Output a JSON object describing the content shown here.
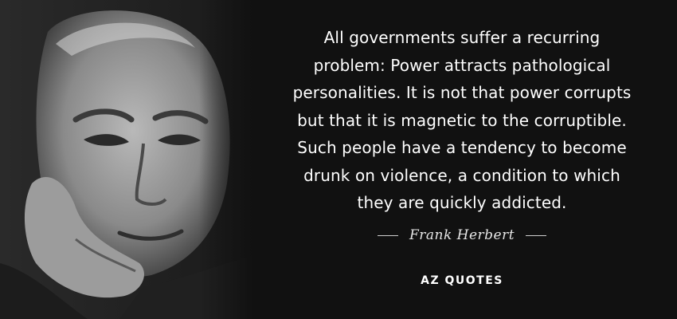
{
  "quote": {
    "lines": [
      "All governments suffer a recurring",
      "problem: Power attracts pathological",
      "personalities. It is not that power corrupts",
      "but that it is magnetic to the corruptible.",
      "Such people have a tendency to become",
      "drunk on violence, a condition to which",
      "they are quickly addicted."
    ]
  },
  "author": "Frank Herbert",
  "brand": "AZ QUOTES",
  "colors": {
    "background": "#111111",
    "text": "#ffffff",
    "author_text": "#e6e6e6"
  }
}
